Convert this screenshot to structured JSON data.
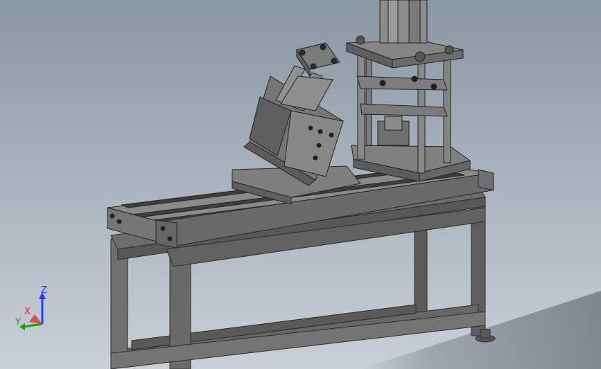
{
  "viewport": {
    "background_top": "#8c97a4",
    "background_bottom": "#c9cfd6",
    "model_color": "#6e6e6e"
  },
  "triad": {
    "z_label": "Z",
    "x_label": "X",
    "y_label": "Y",
    "z_color": "#1f3fff",
    "x_color": "#e02020",
    "y_color": "#15a015"
  }
}
